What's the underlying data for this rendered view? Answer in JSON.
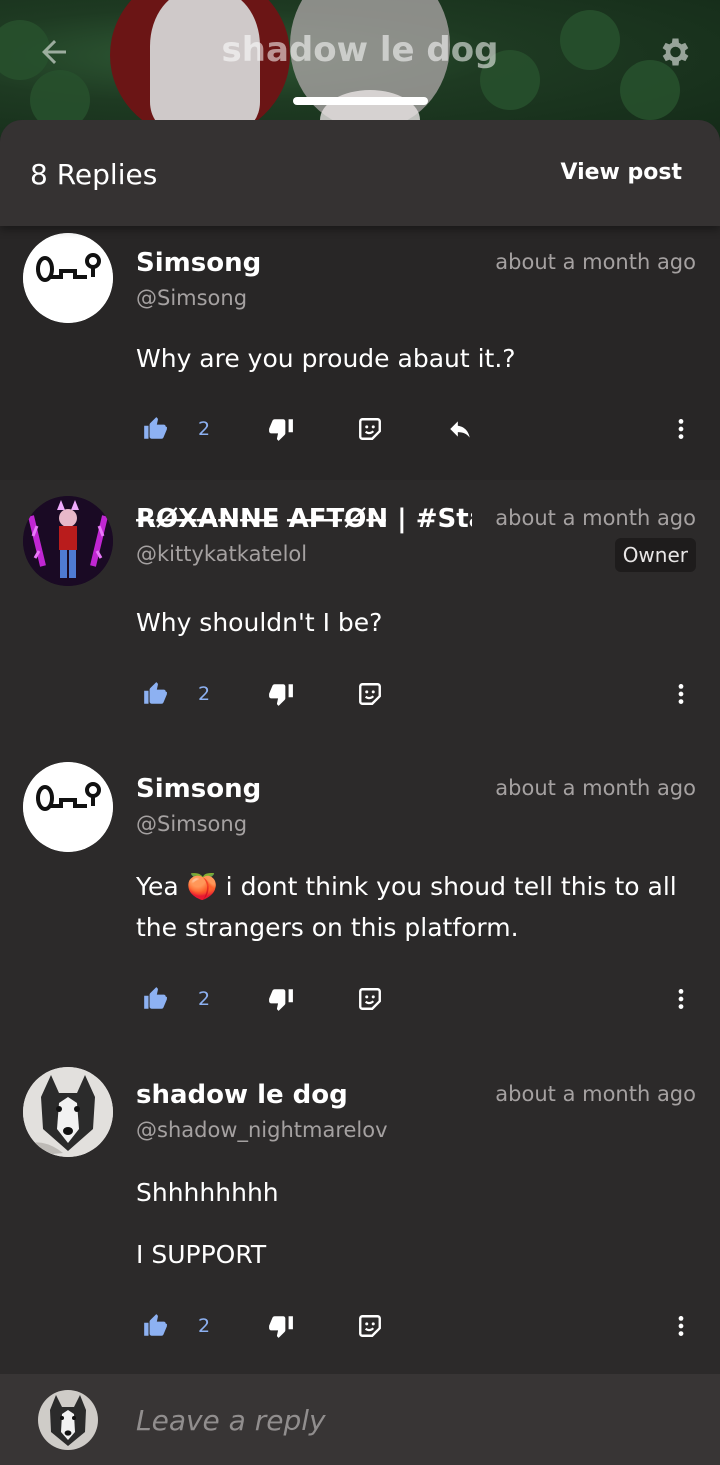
{
  "header": {
    "title": "shadow le dog"
  },
  "sheet": {
    "replies_label": "8 Replies",
    "view_post_label": "View post"
  },
  "comments": [
    {
      "author": "Simsong",
      "handle": "@Simsong",
      "time": "about a month ago",
      "body": "Why are you proude abaut it.?",
      "likes": "2",
      "has_reply_action": true
    },
    {
      "author": "R̶Ø̶X̶A̶N̶N̶E̶ A̶F̶T̶Ø̶N̶ | #Stan",
      "handle": "@kittykatkatelol",
      "time": "about a month ago",
      "badge": "Owner",
      "body": "Why shouldn't I be?",
      "likes": "2"
    },
    {
      "author": "Simsong",
      "handle": "@Simsong",
      "time": "about a month ago",
      "body": "Yea 🍑 i dont think you shoud tell this to all the strangers on this platform.",
      "likes": "2"
    },
    {
      "author": "shadow le dog",
      "handle": "@shadow_nightmarelov",
      "time": "about a month ago",
      "body_line1": "Shhhhhhhh",
      "body_line2": "I SUPPORT",
      "likes": "2"
    }
  ],
  "reply_bar": {
    "placeholder": "Leave a reply"
  },
  "colors": {
    "accent_like": "#8db1f2",
    "sheet_bg": "#2c2a2a",
    "header_bg": "#353232"
  }
}
